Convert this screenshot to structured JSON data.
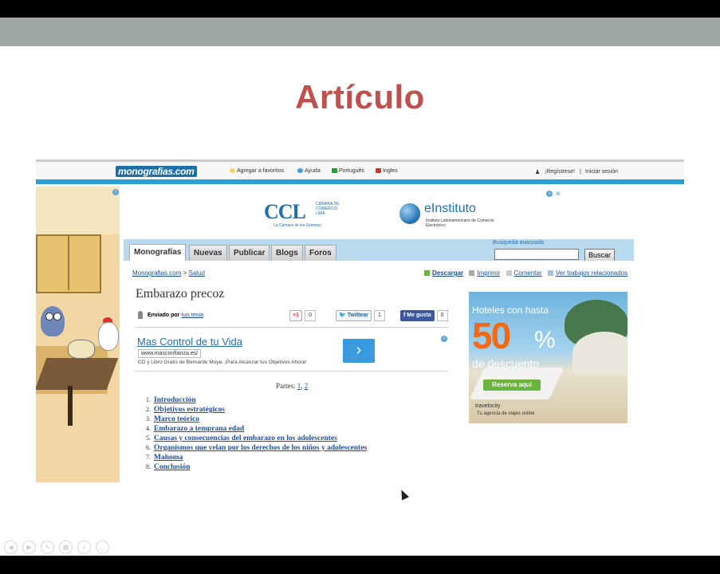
{
  "slide": {
    "title": "Artículo"
  },
  "site": {
    "logo": "monografias.com",
    "header_links": [
      "Agregar a favoritos",
      "Ayuda",
      "Português",
      "Ingles"
    ],
    "register": "¡Regístrese!",
    "separator": "|",
    "login": "Iniciar sesión"
  },
  "banner": {
    "ccl": "CCL",
    "ccl_sub": "CÁMARA DE COMERCIO LIMA",
    "ccl_tag": "La Cámara de los Gremios",
    "einstituto": "eInstituto",
    "einstituto_sub": "Instituto Latinoamericano de Comercio Electrónico"
  },
  "nav": {
    "tabs": [
      "Monografías",
      "Nuevas",
      "Publicar",
      "Blogs",
      "Foros"
    ],
    "advanced_search": "Busqueda avanzada",
    "search_value": "",
    "search_button": "Buscar"
  },
  "breadcrumb": {
    "home": "Monografias.com",
    "sep": ">",
    "section": "Salud"
  },
  "actions": [
    "Descargar",
    "Imprimir",
    "Comentar",
    "Ver trabajos relacionados"
  ],
  "article": {
    "title": "Embarazo precoz",
    "sent_by": "Enviado por",
    "author": "luis tenia"
  },
  "social": {
    "gplus": "+1",
    "gplus_count": "0",
    "twitter": "Twittear",
    "twitter_count": "1",
    "facebook": "Me gusta",
    "facebook_count": "0"
  },
  "text_ad": {
    "headline": "Mas Control de tu Vida",
    "url": "www.masconfianza.es/",
    "desc": "CD y Libro Gratis de Bernardo Moya. ¡Para Alcanzar tus Objetivos Ahora!",
    "arrow": "›"
  },
  "parts": {
    "label": "Partes:",
    "p1": "1",
    "sep": ",",
    "p2": "2"
  },
  "toc": [
    {
      "n": "1.",
      "t": "Introducción"
    },
    {
      "n": "2.",
      "t": "Objetivos estratégicos"
    },
    {
      "n": "3.",
      "t": "Marco teórico"
    },
    {
      "n": "4.",
      "t": "Embarazo a temprana edad"
    },
    {
      "n": "5.",
      "t": "Causas y consecuencias del embarazo en los adolescentes"
    },
    {
      "n": "6.",
      "t": "Organismos que velan por los derechos de los niños y adolescentes"
    },
    {
      "n": "7.",
      "t": "Mahoma"
    },
    {
      "n": "8.",
      "t": "Conclusión"
    }
  ],
  "hotel_ad": {
    "line1": "Hoteles con hasta",
    "number": "50",
    "percent": "%",
    "line2": "de descuento",
    "button": "Reserva aquí",
    "brand": "travelocity",
    "tagline": "Tu agencia de viajes online"
  },
  "colors": {
    "title_red": "#c0504d",
    "link_blue": "#1f4f9f",
    "accent_blue": "#2aa0d8",
    "hotel_orange": "#f06a16"
  }
}
